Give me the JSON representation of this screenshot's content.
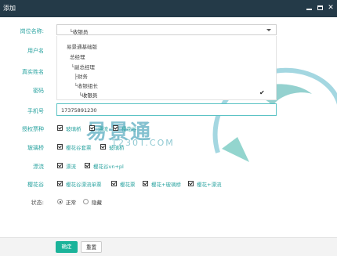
{
  "window": {
    "title": "添加"
  },
  "form": {
    "position_label": "岗位名称:",
    "position_value": "└收银员",
    "position_options": [
      "易景通基础版",
      "总经理",
      "└副总经理",
      "├财务",
      "└收银组长",
      "└收银员"
    ],
    "username_label": "用户名",
    "realname_label": "真实姓名",
    "password_label": "密码",
    "phone_label": "手机号",
    "phone_value": "17375891230",
    "ticket_label": "授权票种",
    "ticket_items": [
      "玻璃桥",
      "漂流",
      "樱花谷"
    ],
    "glassbridge_label": "玻璃桥",
    "glassbridge_items": [
      "樱花谷套票",
      "玻璃桥"
    ],
    "rafting_label": "漂流",
    "rafting_items": [
      "漂流",
      "樱花谷vn+pl"
    ],
    "sakura_label": "樱花谷",
    "sakura_items": [
      "樱花谷漂流单票",
      "樱花票",
      "樱花+玻璃桥",
      "樱花+漂流"
    ],
    "status_label": "状态:",
    "status_options": [
      "正常",
      "隐藏"
    ]
  },
  "watermark": {
    "text": "易景通",
    "sub": "1230T.COM"
  },
  "footer": {
    "confirm_label": "确定",
    "reset_label": "重置"
  }
}
